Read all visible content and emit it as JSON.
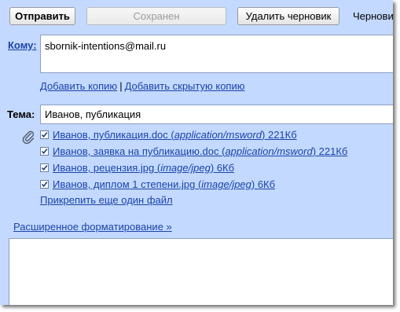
{
  "toolbar": {
    "send_label": "Отправить",
    "saved_label": "Сохранен",
    "delete_draft_label": "Удалить черновик",
    "drafts_partial": "Черновик"
  },
  "to": {
    "label": "Кому:",
    "value": "sbornik-intentions@mail.ru"
  },
  "cc": {
    "add_cc": "Добавить копию",
    "separator": "|",
    "add_bcc": "Добавить скрытую копию"
  },
  "subject": {
    "label": "Тема:",
    "value": "Иванов, публикация"
  },
  "attachments": [
    {
      "name": "Иванов, публикация.doc",
      "open": " (",
      "type": "application/msword",
      "close": ") 221Кб",
      "checked": true
    },
    {
      "name": "Иванов, заявка на публикацию.doc",
      "open": " (",
      "type": "application/msword",
      "close": ") 221Кб",
      "checked": true
    },
    {
      "name": "Иванов, рецензия.jpg",
      "open": " (",
      "type": "image/jpeg",
      "close": ") 6Кб",
      "checked": true
    },
    {
      "name": "Иванов, диплом 1 степени.jpg",
      "open": " (",
      "type": "image/jpeg",
      "close": ") 6Кб",
      "checked": true
    }
  ],
  "attach_more": "Прикрепить еще один файл",
  "rich_formatting": "Расширенное форматирование »",
  "colors": {
    "panel_bg": "#c3d9ff",
    "link": "#1c44a8"
  },
  "icons": [
    "paperclip-icon",
    "checkbox-checked-icon"
  ]
}
